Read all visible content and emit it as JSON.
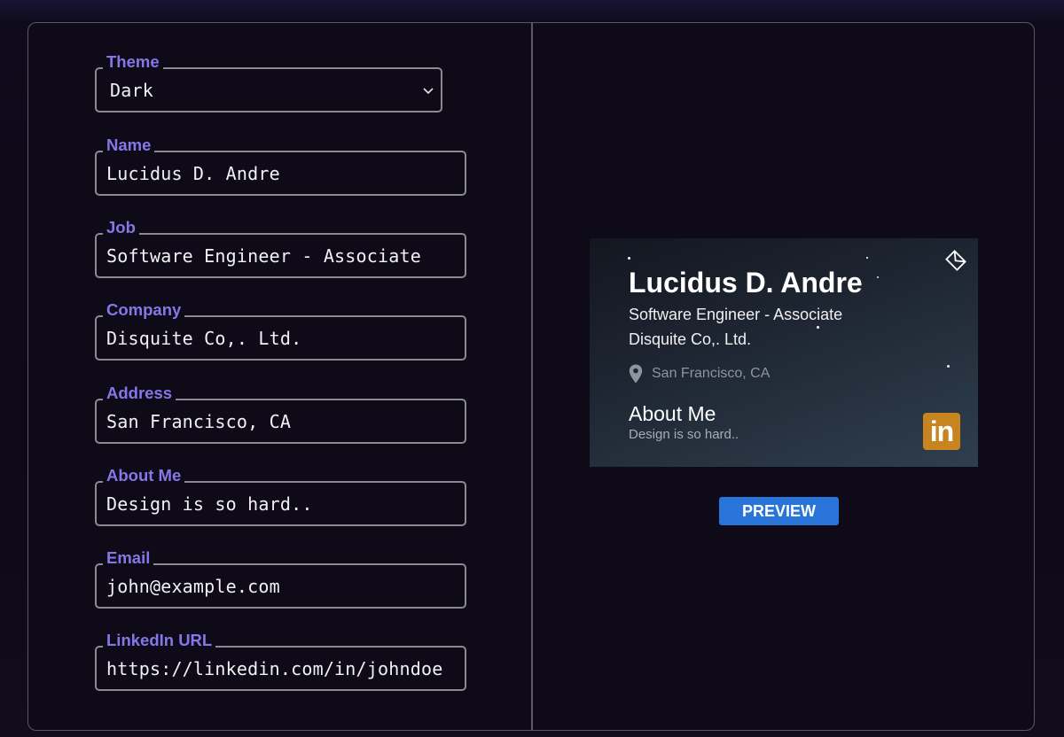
{
  "form": {
    "theme": {
      "label": "Theme",
      "value": "Dark"
    },
    "name": {
      "label": "Name",
      "value": "Lucidus D. Andre"
    },
    "job": {
      "label": "Job",
      "value": "Software Engineer - Associate"
    },
    "company": {
      "label": "Company",
      "value": "Disquite Co,. Ltd."
    },
    "address": {
      "label": "Address",
      "value": "San Francisco, CA"
    },
    "about": {
      "label": "About Me",
      "value": "Design is so hard.."
    },
    "email": {
      "label": "Email",
      "value": "john@example.com"
    },
    "linkedin": {
      "label": "LinkedIn URL",
      "value": "https://linkedin.com/in/johndoe"
    }
  },
  "card": {
    "name": "Lucidus D. Andre",
    "job": "Software Engineer - Associate",
    "company": "Disquite Co,. Ltd.",
    "address": "San Francisco, CA",
    "about_title": "About Me",
    "about": "Design is so hard..",
    "linkedin_badge": "in"
  },
  "preview_button": "PREVIEW",
  "colors": {
    "label_accent": "#8478e8",
    "button": "#2874d8",
    "linkedin_badge": "#c7841f"
  },
  "icons": [
    "chevron-down-icon",
    "email-icon",
    "location-pin-icon",
    "linkedin-icon"
  ]
}
